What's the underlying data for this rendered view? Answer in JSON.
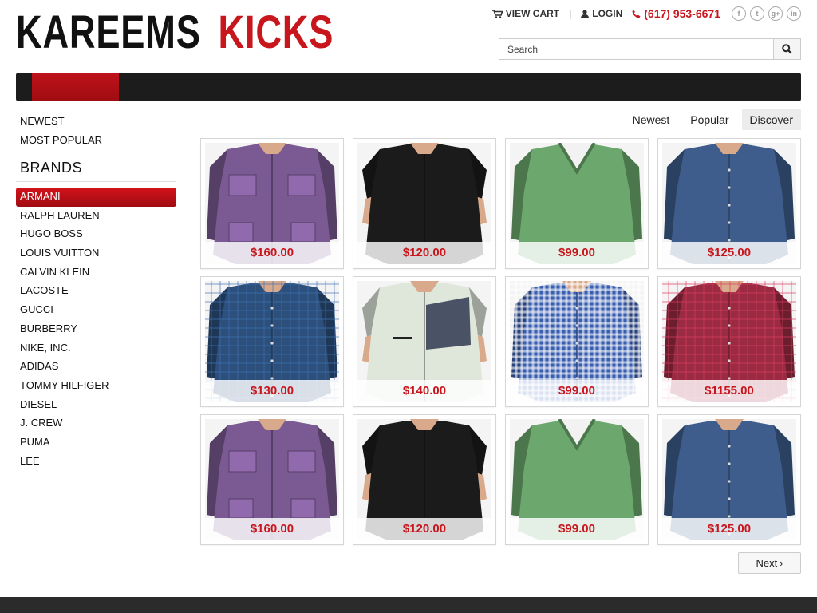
{
  "brand": {
    "word1": "KAREEMS",
    "word2": "KICKS"
  },
  "topbar": {
    "view_cart": "VIEW CART",
    "separator": "|",
    "login": "LOGIN",
    "phone": "(617) 953-6671",
    "socials": [
      {
        "icon": "facebook-icon",
        "glyph": "f"
      },
      {
        "icon": "twitter-icon",
        "glyph": "t"
      },
      {
        "icon": "google-plus-icon",
        "glyph": "g+"
      },
      {
        "icon": "linkedin-icon",
        "glyph": "in"
      }
    ]
  },
  "search": {
    "placeholder": "Search"
  },
  "sidebar": {
    "links": [
      "NEWEST",
      "MOST POPULAR"
    ],
    "brands_title": "BRANDS",
    "brands": [
      "ARMANI",
      "RALPH LAUREN",
      "HUGO BOSS",
      "LOUIS VUITTON",
      "CALVIN KLEIN",
      "LACOSTE",
      "GUCCI",
      "BURBERRY",
      "NIKE, INC.",
      "ADIDAS",
      "TOMMY HILFIGER",
      "DIESEL",
      "J. CREW",
      "PUMA",
      "LEE"
    ],
    "active_brand": "ARMANI"
  },
  "sort_tabs": [
    "Newest",
    "Popular",
    "Discover"
  ],
  "active_sort": "Discover",
  "products": [
    {
      "price": "$160.00",
      "garment": "jacket",
      "color": "#7b5a93"
    },
    {
      "price": "$120.00",
      "garment": "tshirt",
      "color": "#1b1b1b"
    },
    {
      "price": "$99.00",
      "garment": "sweater",
      "color": "#6ca86d"
    },
    {
      "price": "$125.00",
      "garment": "shirt",
      "color": "#3e5d8c"
    },
    {
      "price": "$130.00",
      "garment": "plaid",
      "color": "#2c4f7c"
    },
    {
      "price": "$140.00",
      "garment": "shortsleeve",
      "color": "#dfe6da"
    },
    {
      "price": "$99.00",
      "garment": "gingham",
      "color": "#3a5fb0"
    },
    {
      "price": "$1155.00",
      "garment": "plaidred",
      "color": "#9a2b43"
    },
    {
      "price": "$160.00",
      "garment": "jacket",
      "color": "#7b5a93"
    },
    {
      "price": "$120.00",
      "garment": "tshirt",
      "color": "#1b1b1b"
    },
    {
      "price": "$99.00",
      "garment": "sweater",
      "color": "#6ca86d"
    },
    {
      "price": "$125.00",
      "garment": "shirt",
      "color": "#3e5d8c"
    }
  ],
  "pagination": {
    "next_label": "Next"
  },
  "colors": {
    "accent": "#c8161d",
    "nav_bg": "#1c1c1c",
    "footer_bg": "#2b2b2b"
  }
}
